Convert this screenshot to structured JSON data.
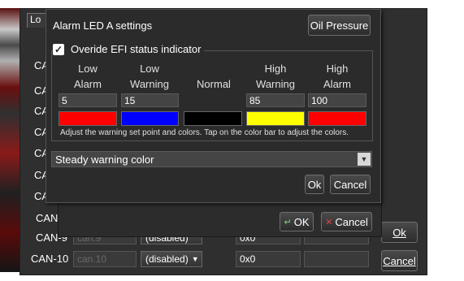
{
  "bg_tab": "Lo",
  "bg_rows": [
    {
      "label": "CAN"
    },
    {
      "label": "CAN-9",
      "id": "can.9",
      "mode": "(disabled)",
      "hex": "0x0"
    },
    {
      "label": "CAN-10",
      "id": "can.10",
      "mode": "(disabled)",
      "hex": "0x0"
    }
  ],
  "side_ok": "Ok",
  "side_cancel": "Cancel",
  "mid_ok": "OK",
  "mid_cancel": "Cancel",
  "dialog": {
    "title": "Alarm LED A settings",
    "sensor_button": "Oil Pressure",
    "override_label": "Overide EFI status indicator",
    "override_checked": true,
    "columns": [
      {
        "line1": "Low",
        "line2": "Alarm",
        "value": "5",
        "color": "#ff0000"
      },
      {
        "line1": "Low",
        "line2": "Warning",
        "value": "15",
        "color": "#0000ff"
      },
      {
        "line1": "",
        "line2": "Normal",
        "value": "",
        "color": "#000000"
      },
      {
        "line1": "High",
        "line2": "Warning",
        "value": "85",
        "color": "#ffff00"
      },
      {
        "line1": "High",
        "line2": "Alarm",
        "value": "100",
        "color": "#ff0000"
      }
    ],
    "hint": "Adjust the warning set point and colors. Tap on the color bar to adjust the colors.",
    "mode_select": "Steady warning color",
    "ok": "Ok",
    "cancel": "Cancel"
  },
  "truncated_labels": [
    "CA",
    "CA",
    "CA",
    "CA",
    "CA",
    "CA",
    "CA"
  ]
}
